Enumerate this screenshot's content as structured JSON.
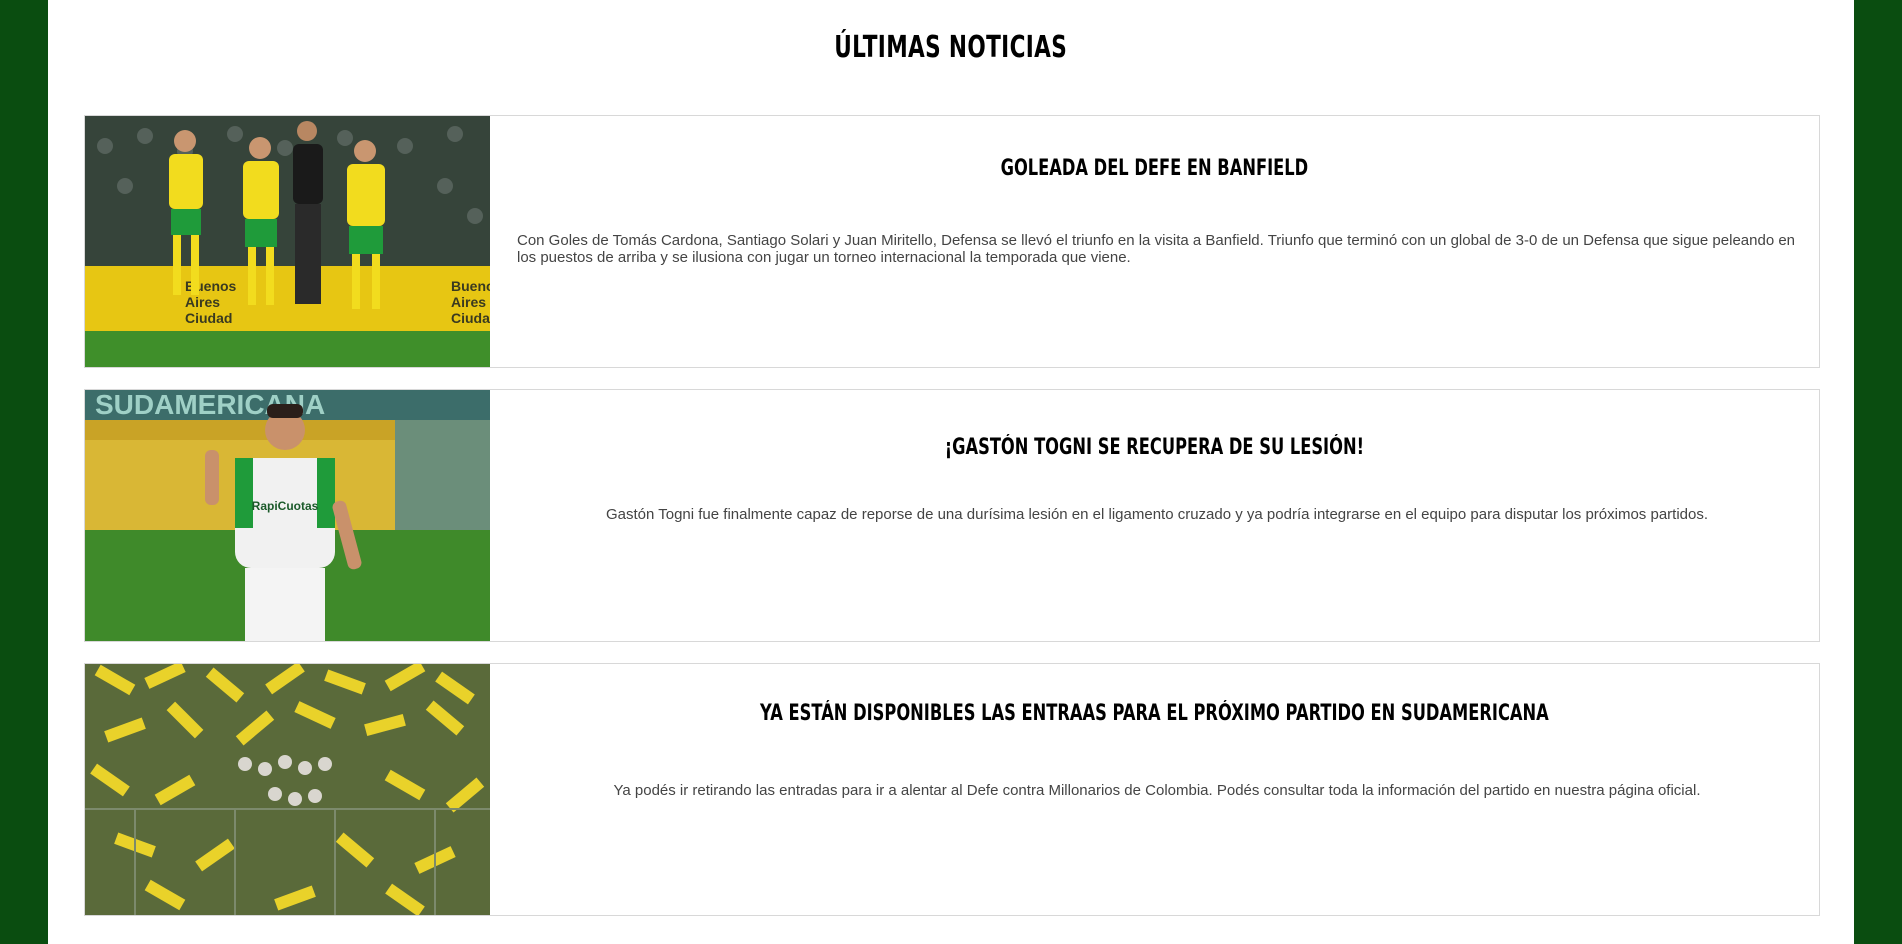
{
  "section": {
    "title": "ÚLTIMAS NOTICIAS"
  },
  "news": [
    {
      "title": "GOLEADA DEL DEFE EN BANFIELD",
      "text": "Con Goles de Tomás Cardona, Santiago Solari y Juan Miritello, Defensa se llevó el triunfo en la visita a Banfield. Triunfo que terminó con un global de 3-0 de un Defensa que sigue peleando en los puestos de arriba y se ilusiona con jugar un torneo internacional la temporada que viene.",
      "image_sign_text": [
        "Buenos",
        "Aires",
        "Ciudad"
      ]
    },
    {
      "title": "¡GASTÓN TOGNI SE RECUPERA DE SU LESIÓN!",
      "text": "Gastón Togni fue finalmente capaz de reporse de una durísima lesión en el ligamento cruzado y ya podría integrarse en el equipo para disputar los próximos partidos.",
      "image_sign_text": [
        "SUDAMERICANA",
        "RapiCuotas"
      ]
    },
    {
      "title": "YA ESTÁN DISPONIBLES LAS ENTRAAS PARA EL PRÓXIMO PARTIDO EN SUDAMERICANA",
      "text": "Ya podés ir retirando las entradas para ir a alentar al Defe contra Millonarios de Colombia. Podés consultar toda la información del partido en nuestra página oficial."
    }
  ],
  "colors": {
    "page_background": "#0a4d10",
    "card_border": "#d8d8d8",
    "kit_yellow": "#f2dc1e",
    "kit_green": "#1f9b3a"
  }
}
